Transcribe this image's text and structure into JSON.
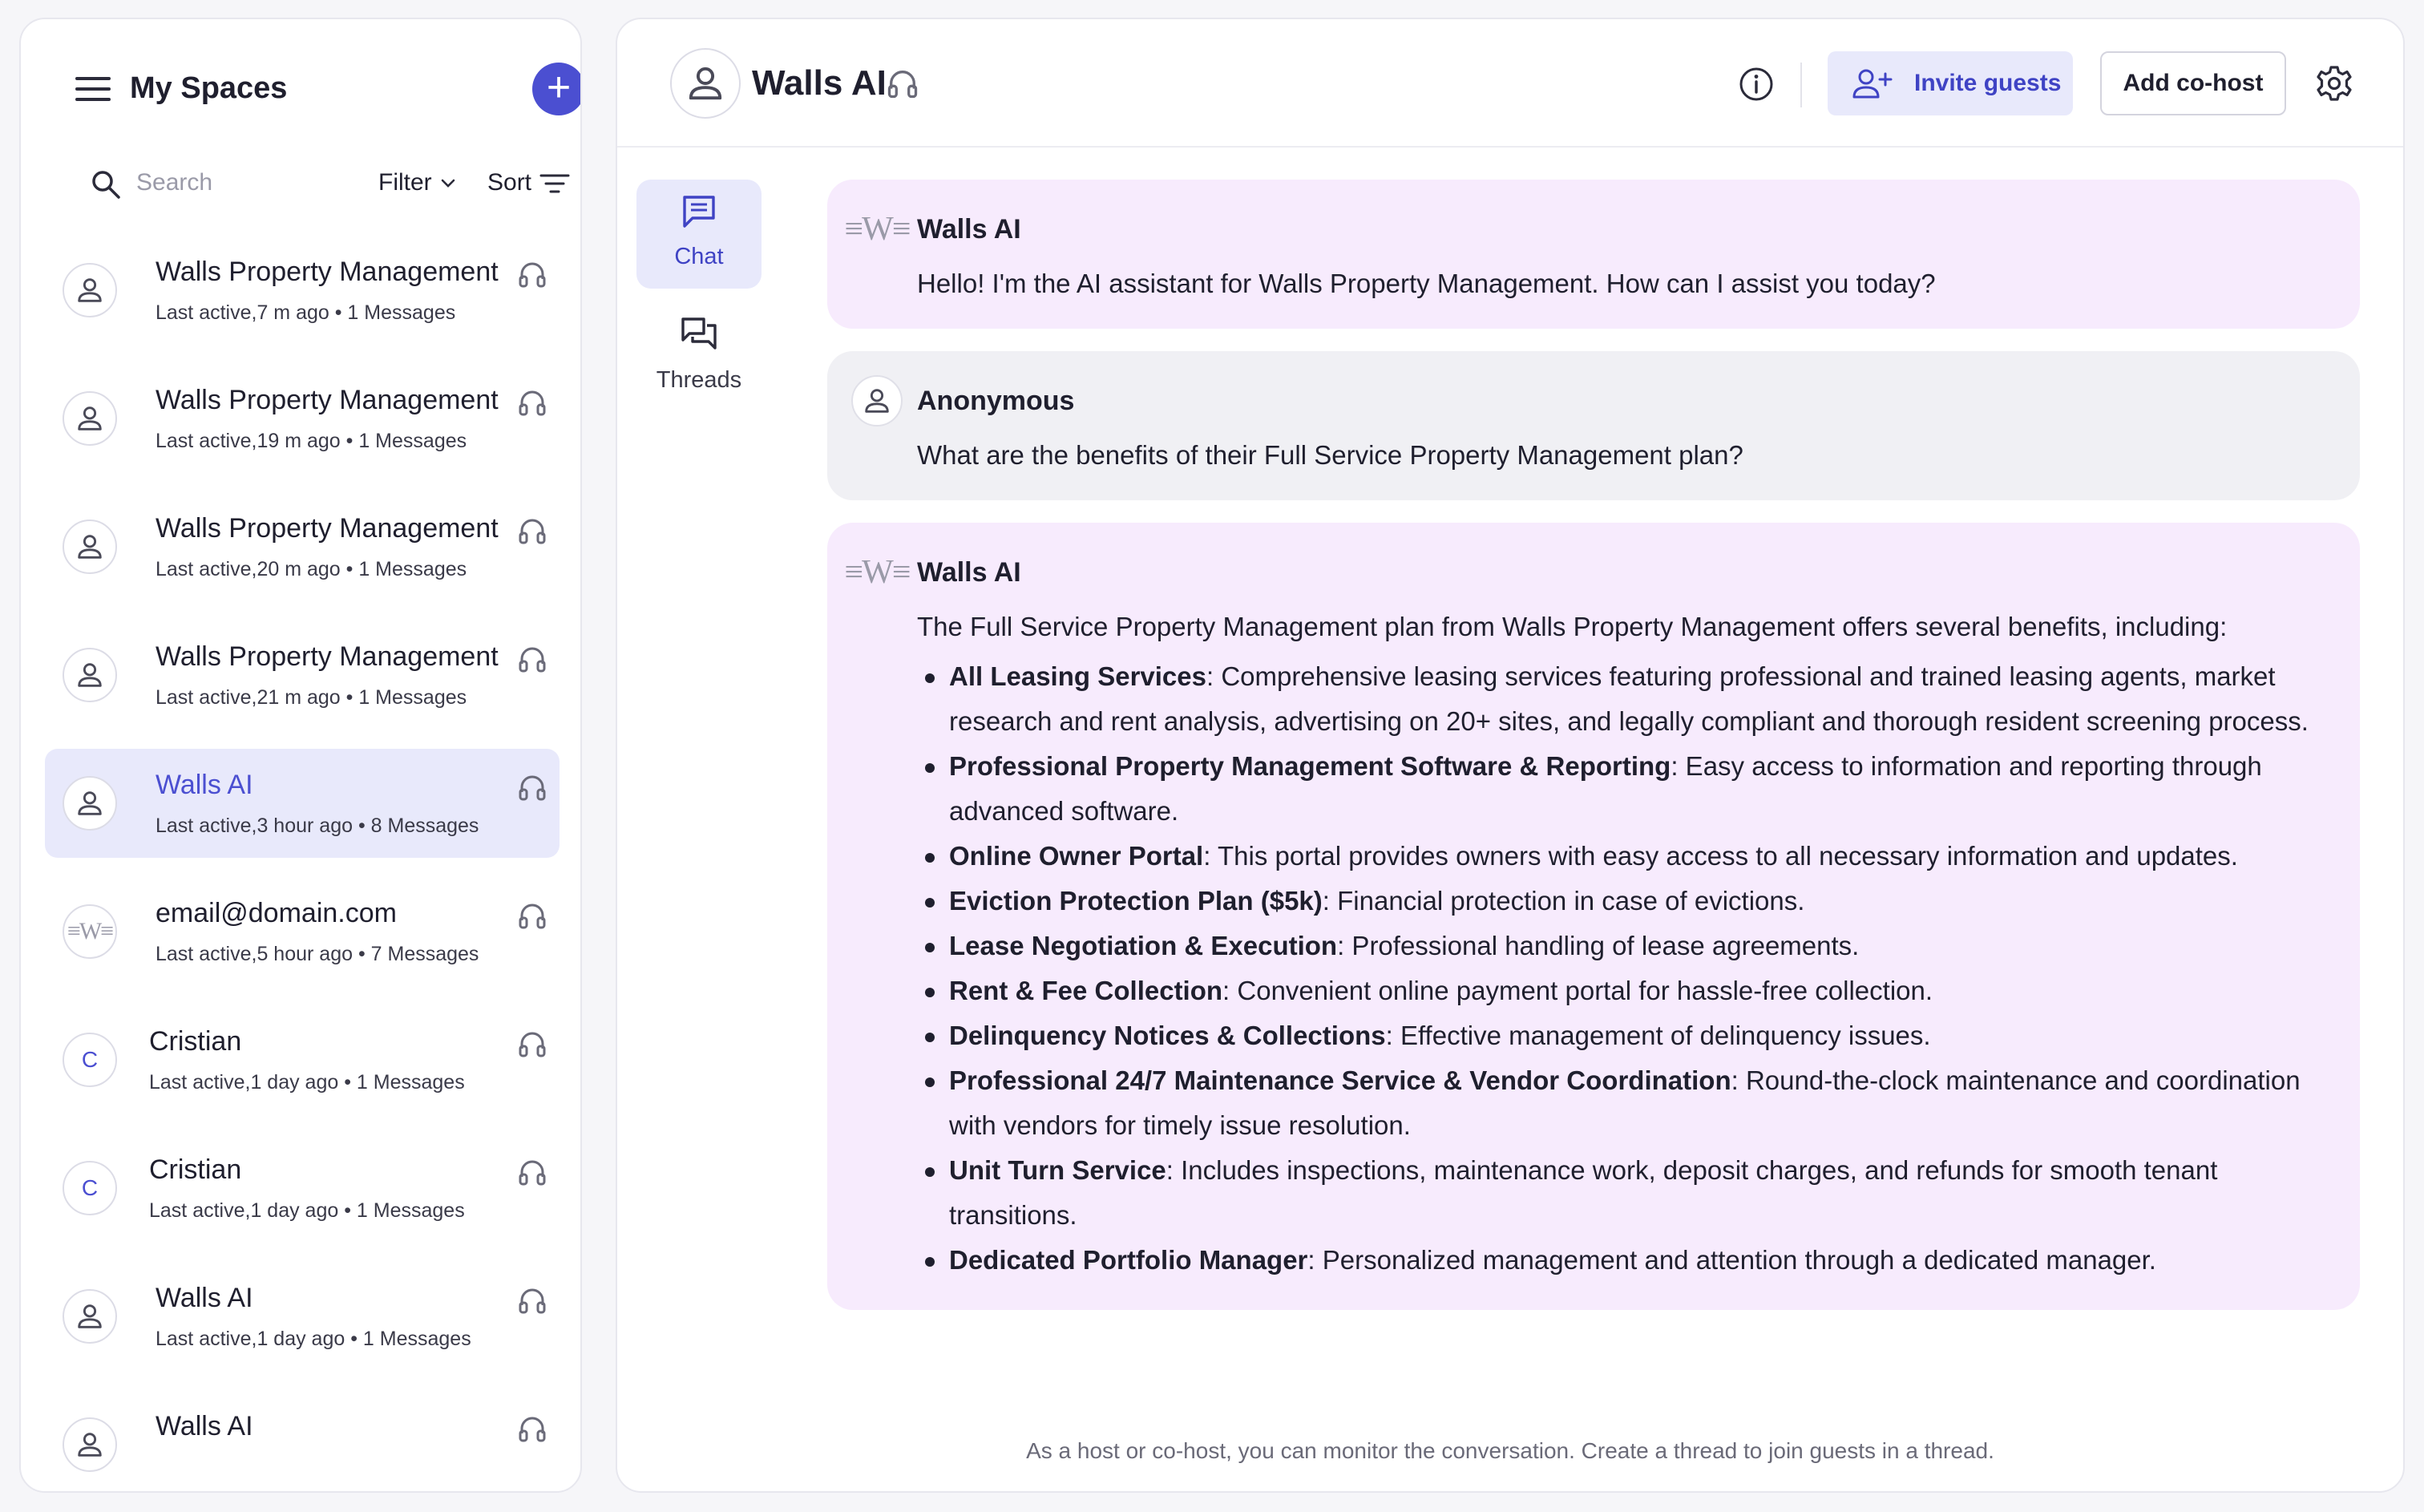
{
  "sidebar": {
    "title": "My Spaces",
    "search_placeholder": "Search",
    "filter_label": "Filter",
    "sort_label": "Sort",
    "items": [
      {
        "title": "Walls Property Management",
        "subtitle": "Last active,7 m ago • 1 Messages",
        "avatar": "person-icon",
        "active": false
      },
      {
        "title": "Walls Property Management",
        "subtitle": "Last active,19 m ago • 1 Messages",
        "avatar": "person-icon",
        "active": false
      },
      {
        "title": "Walls Property Management",
        "subtitle": "Last active,20 m ago • 1 Messages",
        "avatar": "person-icon",
        "active": false
      },
      {
        "title": "Walls Property Management",
        "subtitle": "Last active,21 m ago • 1 Messages",
        "avatar": "person-icon",
        "active": false
      },
      {
        "title": "Walls AI",
        "subtitle": "Last active,3 hour ago • 8 Messages",
        "avatar": "person-icon",
        "active": true
      },
      {
        "title": "email@domain.com",
        "subtitle": "Last active,5 hour ago • 7 Messages",
        "avatar": "walls-logo",
        "active": false
      },
      {
        "title": "Cristian",
        "subtitle": "Last active,1 day ago • 1 Messages",
        "avatar_letter": "C",
        "active": false
      },
      {
        "title": "Cristian",
        "subtitle": "Last active,1 day ago • 1 Messages",
        "avatar_letter": "C",
        "active": false
      },
      {
        "title": "Walls AI",
        "subtitle": "Last active,1 day ago • 1 Messages",
        "avatar": "person-icon",
        "active": false
      },
      {
        "title": "Walls AI",
        "subtitle": "",
        "avatar": "person-icon",
        "active": false
      }
    ]
  },
  "header": {
    "title": "Walls AI",
    "invite_label": "Invite guests",
    "cohost_label": "Add co-host"
  },
  "tabs": [
    {
      "label": "Chat",
      "active": true
    },
    {
      "label": "Threads",
      "active": false
    }
  ],
  "messages": {
    "m1": {
      "sender": "Walls AI",
      "text": "Hello! I'm the AI assistant for Walls Property Management. How can I assist you today?"
    },
    "m2": {
      "sender": "Anonymous",
      "text": "What are the benefits of their Full Service Property Management plan?"
    },
    "m3": {
      "sender": "Walls AI",
      "intro": "The Full Service Property Management plan from Walls Property Management offers several benefits, including:",
      "benefits": [
        {
          "title": "All Leasing Services",
          "desc": ": Comprehensive leasing services featuring professional and trained leasing agents, market research and rent analysis, advertising on 20+ sites, and legally compliant and thorough resident screening process."
        },
        {
          "title": "Professional Property Management Software & Reporting",
          "desc": ": Easy access to information and reporting through advanced software."
        },
        {
          "title": "Online Owner Portal",
          "desc": ": This portal provides owners with easy access to all necessary information and updates."
        },
        {
          "title": "Eviction Protection Plan ($5k)",
          "desc": ": Financial protection in case of evictions."
        },
        {
          "title": "Lease Negotiation & Execution",
          "desc": ": Professional handling of lease agreements."
        },
        {
          "title": "Rent & Fee Collection",
          "desc": ": Convenient online payment portal for hassle-free collection."
        },
        {
          "title": "Delinquency Notices & Collections",
          "desc": ": Effective management of delinquency issues."
        },
        {
          "title": "Professional 24/7 Maintenance Service & Vendor Coordination",
          "desc": ": Round-the-clock maintenance and coordination with vendors for timely issue resolution."
        },
        {
          "title": "Unit Turn Service",
          "desc": ": Includes inspections, maintenance work, deposit charges, and refunds for smooth tenant transitions."
        },
        {
          "title": "Dedicated Portfolio Manager",
          "desc": ": Personalized management and attention through a dedicated manager."
        }
      ]
    }
  },
  "footer_note": "As a host or co-host, you can monitor the conversation. Create a thread to join guests in a thread.",
  "colors": {
    "accent": "#4b4fd1",
    "ai_bubble": "#f7ebfd",
    "user_bubble": "#f0f0f4",
    "active_item": "#e8e9fb"
  }
}
